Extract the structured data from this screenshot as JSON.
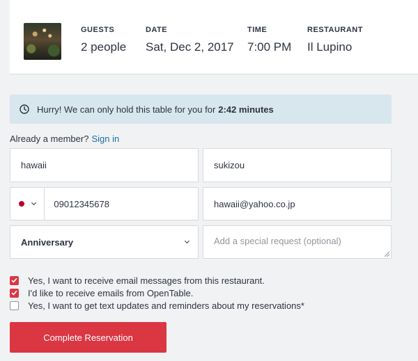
{
  "summary": {
    "guests": {
      "label": "GUESTS",
      "value": "2 people"
    },
    "date": {
      "label": "DATE",
      "value": "Sat, Dec 2, 2017"
    },
    "time": {
      "label": "TIME",
      "value": "7:00 PM"
    },
    "restaurant": {
      "label": "RESTAURANT",
      "value": "Il Lupino"
    }
  },
  "alert": {
    "text": "Hurry! We can only hold this table for you for",
    "timer": "2:42 minutes"
  },
  "member": {
    "prompt": "Already a member?",
    "link": "Sign in"
  },
  "form": {
    "first_name": "hawaii",
    "last_name": "sukizou",
    "phone": "09012345678",
    "email": "hawaii@yahoo.co.jp",
    "occasion": "Anniversary",
    "special_request_placeholder": "Add a special request (optional)"
  },
  "checkboxes": [
    {
      "label": "Yes, I want to receive email messages from this restaurant.",
      "checked": true
    },
    {
      "label": "I'd like to receive emails from OpenTable.",
      "checked": true
    },
    {
      "label": "Yes, I want to get text updates and reminders about my reservations*",
      "checked": false
    }
  ],
  "submit_label": "Complete Reservation",
  "colors": {
    "accent": "#da3743",
    "alert_bg": "#d8e6ee",
    "link": "#1e6f9f"
  }
}
